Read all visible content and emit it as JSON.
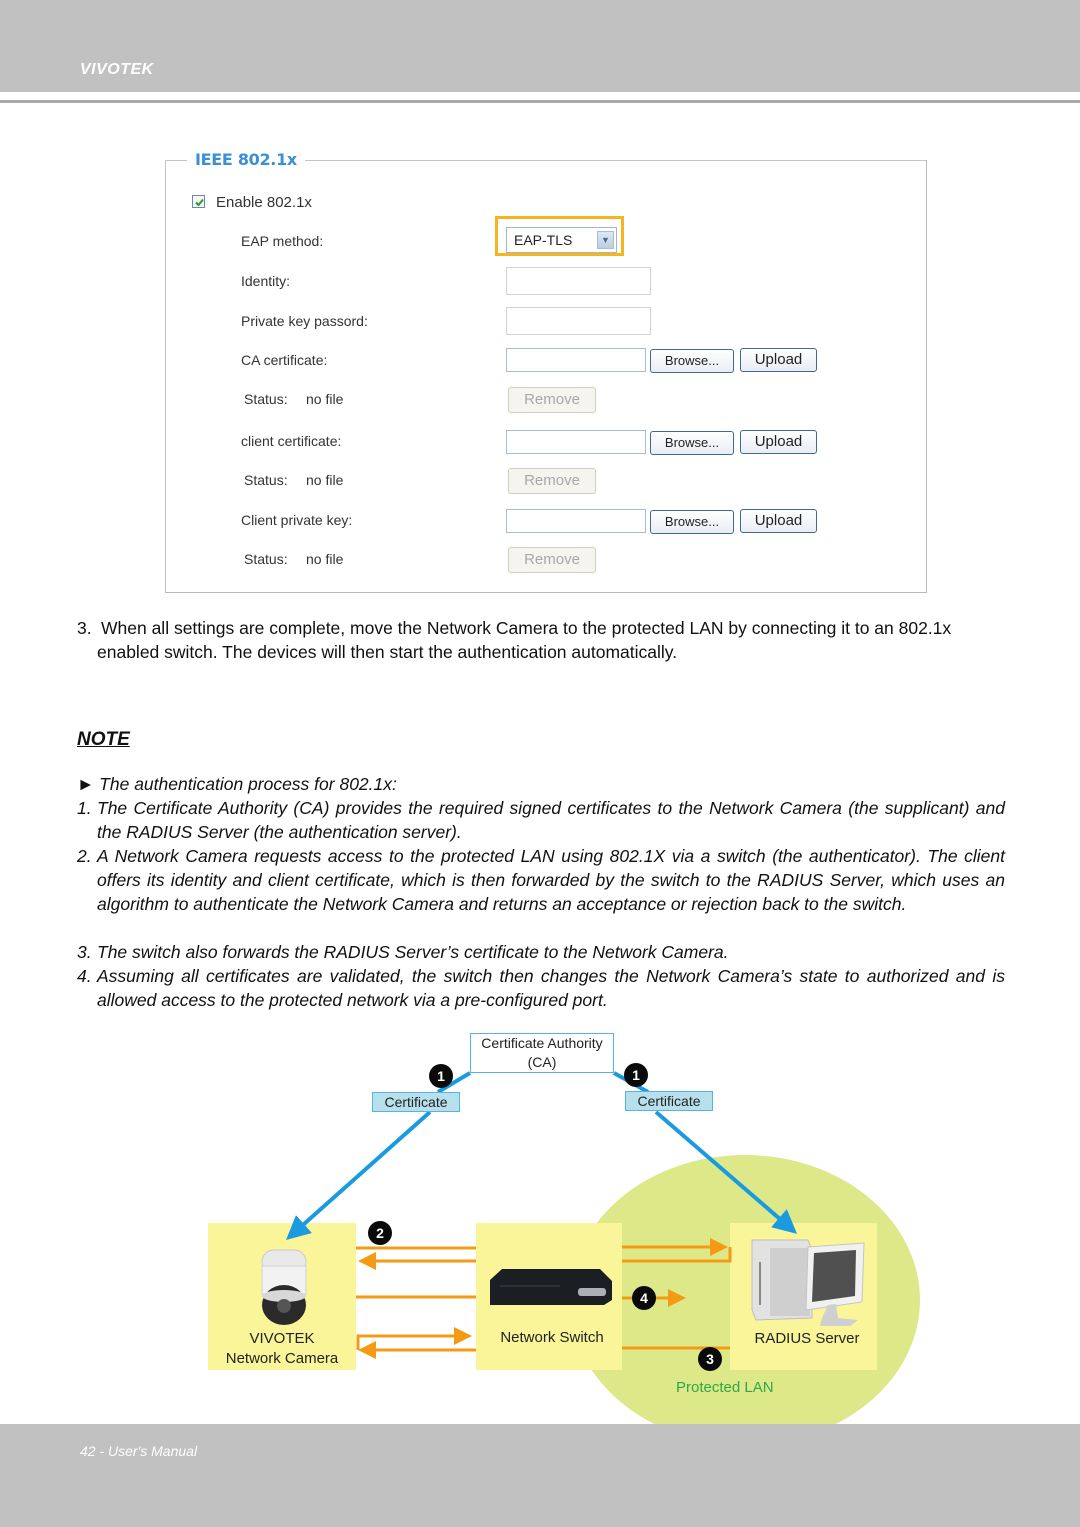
{
  "header": {
    "brand": "VIVOTEK"
  },
  "form": {
    "legend": "IEEE 802.1x",
    "enable_label": "Enable 802.1x",
    "enable_checked": true,
    "eap_method_label": "EAP method:",
    "eap_method_value": "EAP-TLS",
    "identity_label": "Identity:",
    "identity_value": "",
    "private_key_password_label": "Private key passord:",
    "private_key_password_value": "",
    "rows": [
      {
        "label": "CA certificate:",
        "status_label": "Status:",
        "status_value": "no file"
      },
      {
        "label": "client certificate:",
        "status_label": "Status:",
        "status_value": "no file"
      },
      {
        "label": "Client private key:",
        "status_label": "Status:",
        "status_value": "no file"
      }
    ],
    "browse_label": "Browse...",
    "upload_label": "Upload",
    "remove_label": "Remove",
    "highlight_color": "#f6b41d",
    "legend_color": "#3a8fd6"
  },
  "step3": {
    "number": "3.",
    "text": "When all settings are complete, move the Network Camera to the protected LAN by connecting it to an 802.1x enabled switch. The devices will then start the authentication automatically."
  },
  "note": {
    "title": "NOTE",
    "intro": "► The authentication process for 802.1x:",
    "items": [
      {
        "num": "1.",
        "text": "The Certificate Authority (CA) provides the required signed certificates to the Network Camera (the supplicant) and the RADIUS Server (the authentication server)."
      },
      {
        "num": "2.",
        "text": "A Network Camera requests access to the protected LAN using 802.1X via a switch (the authenticator). The client offers its identity and client certificate, which is then forwarded by the switch to the RADIUS Server, which uses an algorithm to authenticate the Network Camera and returns an acceptance or rejection back to the switch."
      },
      {
        "num": "3.",
        "text": "The switch also forwards the RADIUS Server’s certificate to the Network Camera."
      },
      {
        "num": "4.",
        "text": "Assuming all certificates are validated, the switch then changes the Network Camera’s state to authorized and is allowed access to the protected network via a pre-configured port."
      }
    ]
  },
  "diagram": {
    "ca_line1": "Certificate Authority",
    "ca_line2": "(CA)",
    "cert_left": "Certificate",
    "cert_right": "Certificate",
    "badges": [
      "1",
      "1",
      "2",
      "4",
      "3"
    ],
    "camera_line1": "VIVOTEK",
    "camera_line2": "Network Camera",
    "switch_label": "Network Switch",
    "server_label": "RADIUS Server",
    "lan_label": "Protected LAN",
    "colors": {
      "cert_arrow": "#1a9be0",
      "flow_arrow": "#f59a14",
      "node_fill": "#fbf59a",
      "lan_fill": "#dde888",
      "lan_text": "#2fa84a"
    }
  },
  "footer": {
    "text": "42 - User's Manual"
  }
}
